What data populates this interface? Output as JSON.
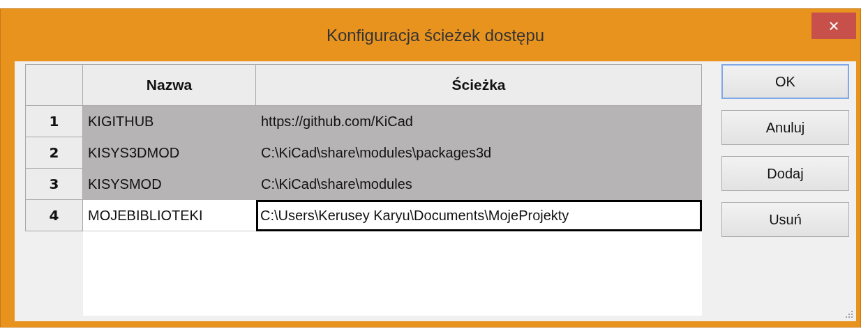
{
  "window": {
    "title": "Konfiguracja ścieżek dostępu",
    "close_button": "×"
  },
  "table": {
    "columns": [
      "Nazwa",
      "Ścieżka"
    ],
    "rows": [
      {
        "number": "1",
        "name": "KIGITHUB",
        "path": "https://github.com/KiCad",
        "selected": true,
        "editing": false
      },
      {
        "number": "2",
        "name": "KISYS3DMOD",
        "path": "C:\\KiCad\\share\\modules\\packages3d",
        "selected": true,
        "editing": false
      },
      {
        "number": "3",
        "name": "KISYSMOD",
        "path": "C:\\KiCad\\share\\modules",
        "selected": true,
        "editing": false
      },
      {
        "number": "4",
        "name": "MOJEBIBLIOTEKI",
        "path": "C:\\Users\\Kerusey Karyu\\Documents\\MojeProjekty",
        "selected": false,
        "editing": true
      }
    ]
  },
  "buttons": [
    {
      "label": "OK",
      "default": true
    },
    {
      "label": "Anuluj",
      "default": false
    },
    {
      "label": "Dodaj",
      "default": false
    },
    {
      "label": "Usuń",
      "default": false
    }
  ]
}
